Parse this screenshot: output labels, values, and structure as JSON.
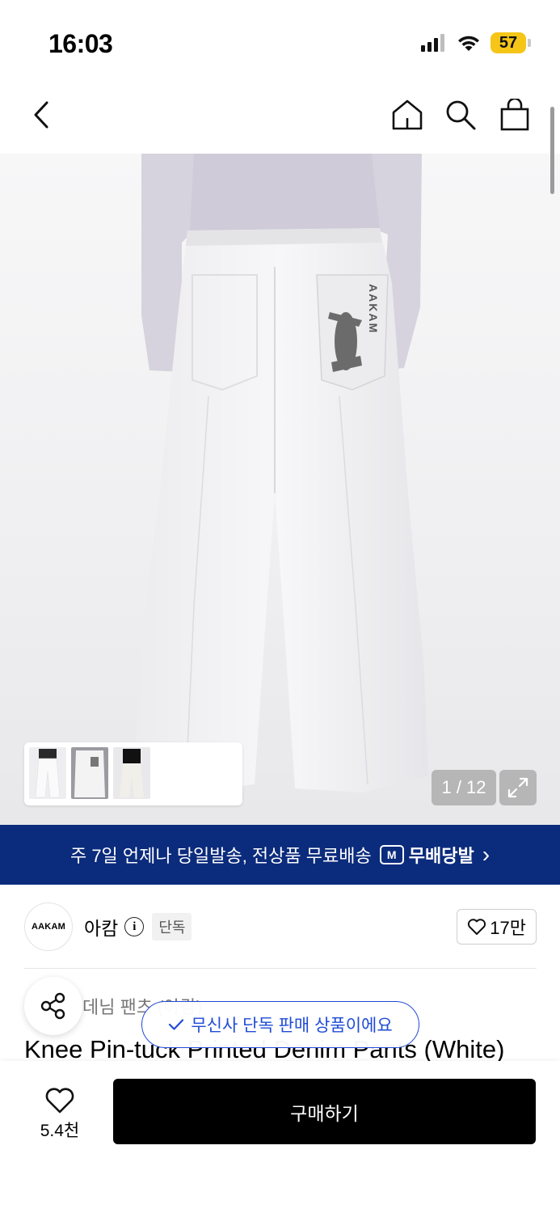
{
  "status": {
    "time": "16:03",
    "battery": "57",
    "icons": [
      "signal-icon",
      "wifi-icon",
      "battery-icon"
    ]
  },
  "nav": {
    "icons": [
      "back-icon",
      "home-icon",
      "search-icon",
      "shopping-bag-icon"
    ]
  },
  "gallery": {
    "counter": "1 / 12",
    "print_text": "AAKAM",
    "thumbnails": 3
  },
  "promo": {
    "text": "주 7일 언제나 당일발송, 전상품 무료배송",
    "logo_letter": "M",
    "brand": "무배당발",
    "chevron": "›",
    "background": "#0b2b7c"
  },
  "brand": {
    "logo_text": "AAKAM",
    "name": "아캄",
    "info": "i",
    "badge": "단독",
    "like_count": "17만"
  },
  "product": {
    "category": "데님 팬츠 (아캄)",
    "title": "Knee Pin-tuck Printed Denim Pants (White)"
  },
  "toast": {
    "text": "무신사 단독 판매 상품이에요",
    "accent": "#1f4cd6"
  },
  "bottom": {
    "like_count": "5.4천",
    "buy_label": "구매하기"
  }
}
